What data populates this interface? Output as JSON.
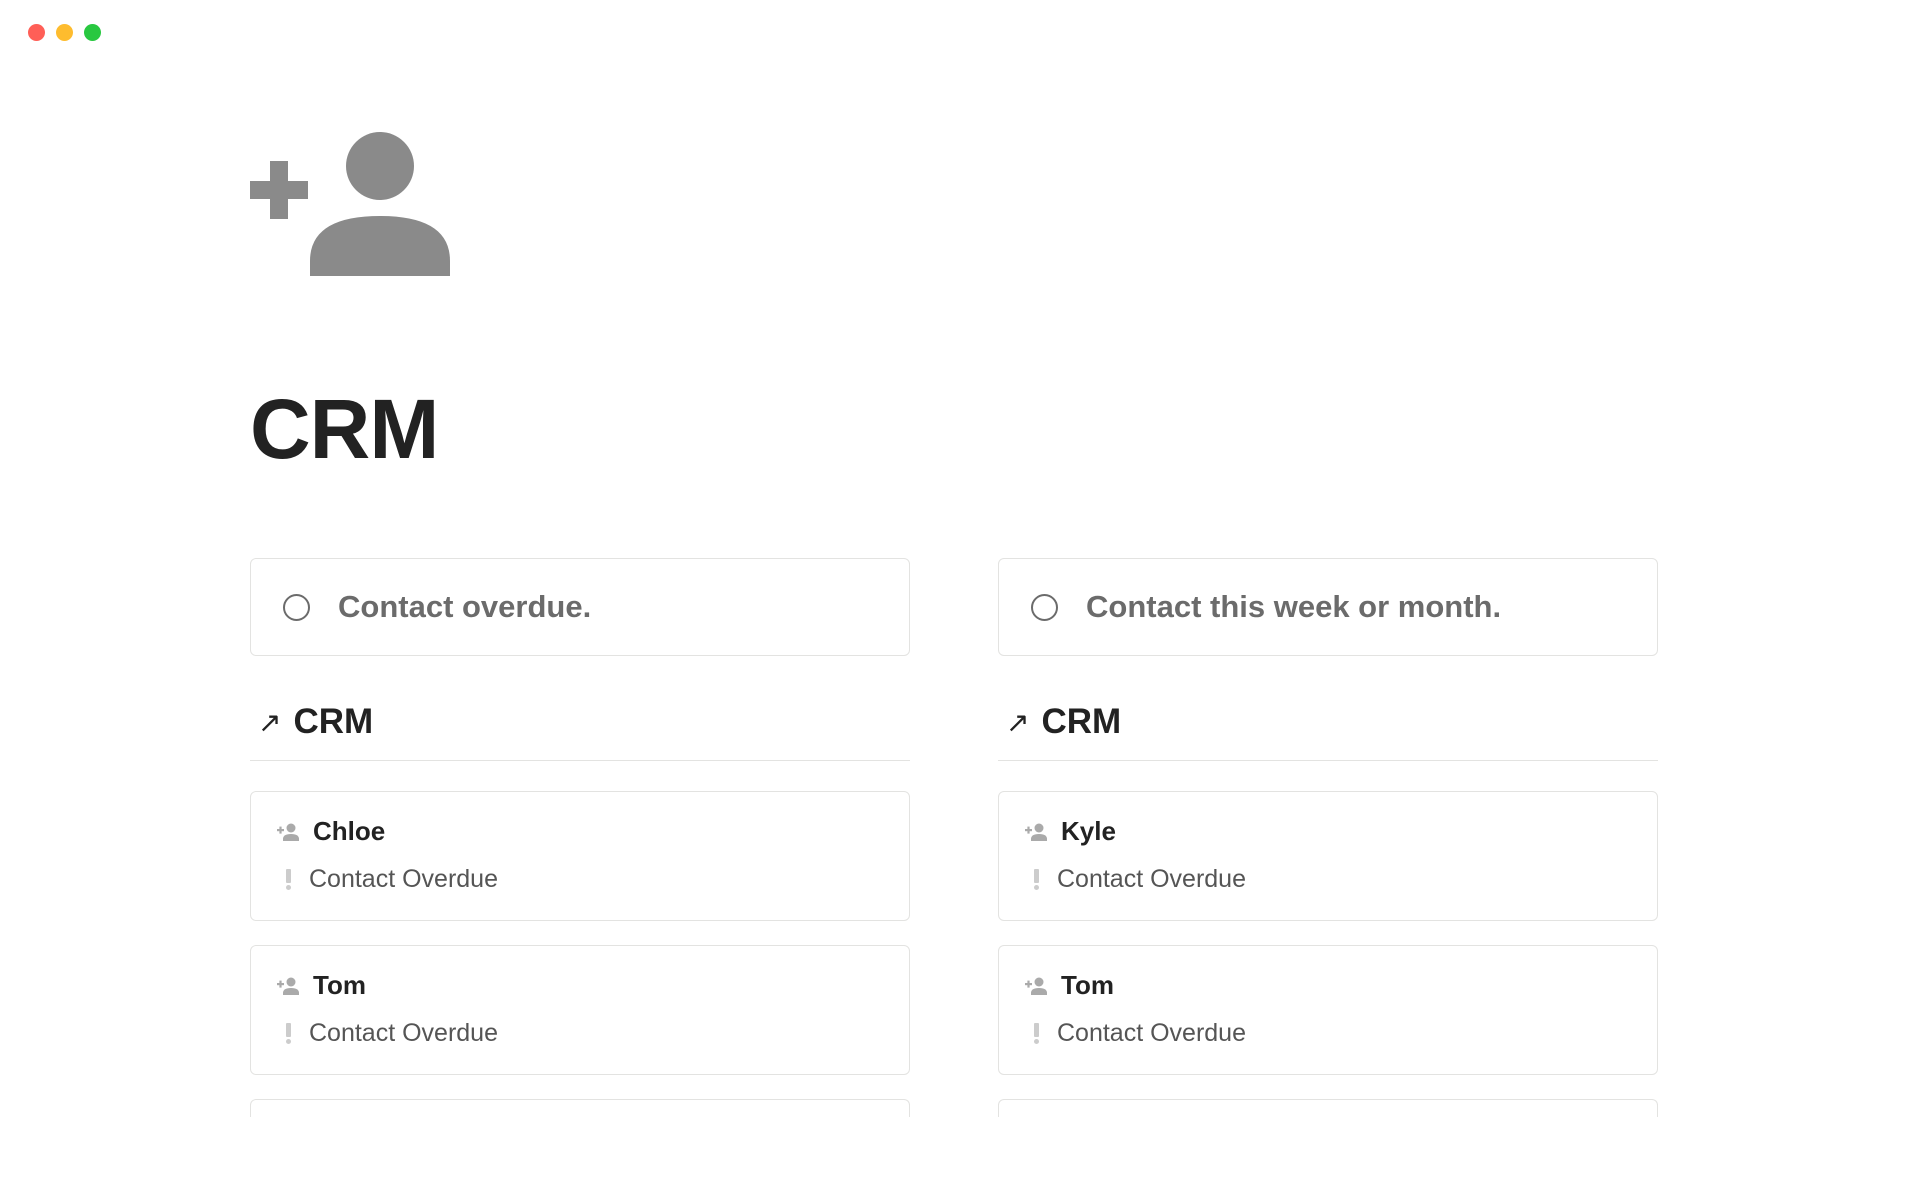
{
  "page": {
    "title": "CRM"
  },
  "columns": [
    {
      "callout": "Contact overdue.",
      "section_title": "CRM",
      "cards": [
        {
          "name": "Chloe",
          "status": "Contact Overdue"
        },
        {
          "name": "Tom",
          "status": "Contact Overdue"
        }
      ]
    },
    {
      "callout": "Contact this week or month.",
      "section_title": "CRM",
      "cards": [
        {
          "name": "Kyle",
          "status": "Contact Overdue"
        },
        {
          "name": "Tom",
          "status": "Contact Overdue"
        }
      ]
    }
  ]
}
